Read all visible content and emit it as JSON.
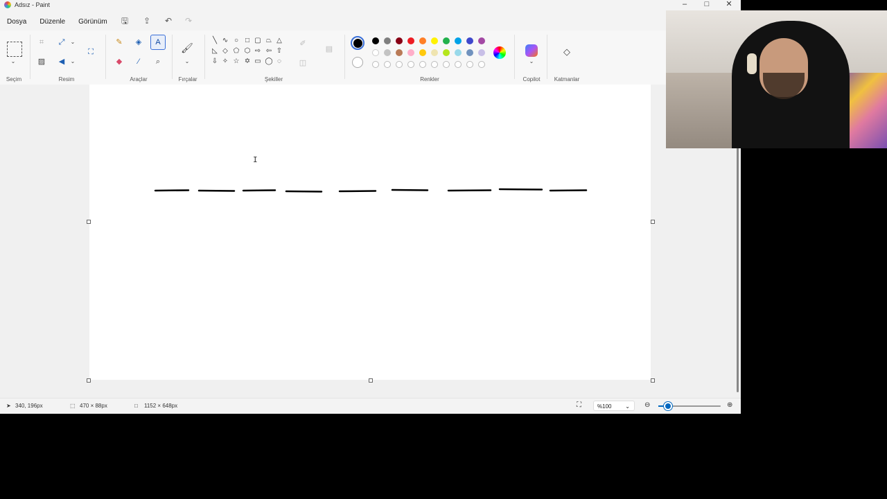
{
  "window": {
    "title": "Adsız - Paint"
  },
  "menu": [
    "Dosya",
    "Düzenle",
    "Görünüm"
  ],
  "ribbon": {
    "groups": {
      "selection": "Seçim",
      "image": "Resim",
      "tools": "Araçlar",
      "brushes": "Fırçalar",
      "shapes": "Şekiller",
      "colors": "Renkler",
      "copilot": "Copilot",
      "layers": "Katmanlar"
    },
    "palette_row1": [
      "#000000",
      "#7f7f7f",
      "#880015",
      "#ed1c24",
      "#ff7f27",
      "#fff200",
      "#22b14c",
      "#00a2e8",
      "#3f48cc",
      "#a349a4"
    ],
    "palette_row2": [
      "#ffffff",
      "#c3c3c3",
      "#b97a57",
      "#ffaec9",
      "#ffc90e",
      "#efe4b0",
      "#b5e61d",
      "#99d9ea",
      "#7092be",
      "#c8bfe7"
    ],
    "primary_color": "#000000",
    "secondary_color": "#ffffff"
  },
  "canvas": {
    "dash_count": 9
  },
  "status": {
    "cursor_position": "340, 196px",
    "selection_size": "470 × 88px",
    "image_size": "1152 × 648px",
    "zoom": "%100"
  }
}
